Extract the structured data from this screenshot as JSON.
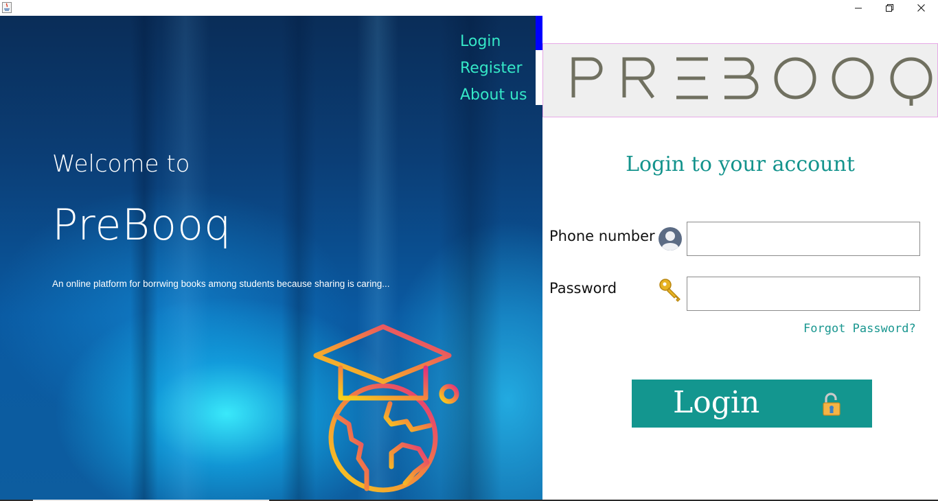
{
  "window": {
    "controls": {
      "minimize_icon": "minimize-icon",
      "maximize_icon": "restore-icon",
      "close_icon": "close-icon"
    }
  },
  "nav": {
    "items": [
      {
        "label": "Login"
      },
      {
        "label": "Register"
      },
      {
        "label": "About us"
      }
    ],
    "active": "Login"
  },
  "hero": {
    "welcome": "Welcome to",
    "brand": "PreBooq",
    "tagline": "An online platform for borrwing books among students because sharing is caring..."
  },
  "logo": {
    "text": "PREBOOQ"
  },
  "form": {
    "title": "Login to your account",
    "phone_label": "Phone number",
    "phone_value": "",
    "password_label": "Password",
    "password_value": "",
    "forgot_label": "Forgot Password?",
    "submit_label": "Login"
  },
  "colors": {
    "accent": "#13968f",
    "nav_text": "#35e8c7",
    "active_indicator": "#0000ff"
  }
}
